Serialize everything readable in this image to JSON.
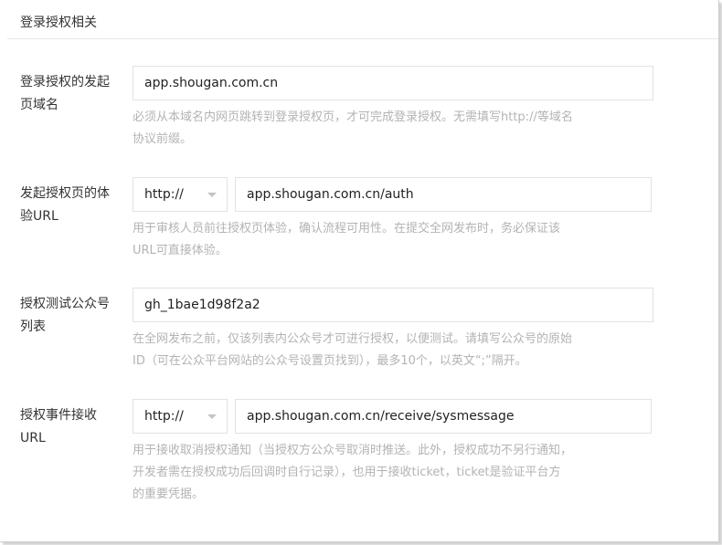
{
  "section": {
    "title": "登录授权相关"
  },
  "fields": [
    {
      "label_line1": "登录授权的发起",
      "label_line2": "页域名",
      "value": "app.shougan.com.cn",
      "hint_line1": "必须从本域名内网页跳转到登录授权页，才可完成登录授权。无需填写http://等域名",
      "hint_line2": "协议前缀。"
    },
    {
      "label_line1": "发起授权页的体",
      "label_line2": "验URL",
      "protocol": "http://",
      "value": "app.shougan.com.cn/auth",
      "hint_line1": "用于审核人员前往授权页体验，确认流程可用性。在提交全网发布时，务必保证该",
      "hint_line2": "URL可直接体验。"
    },
    {
      "label_line1": "授权测试公众号",
      "label_line2": "列表",
      "value": "gh_1bae1d98f2a2",
      "hint_line1": "在全网发布之前，仅该列表内公众号才可进行授权，以便测试。请填写公众号的原始",
      "hint_line2": "ID（可在公众平台网站的公众号设置页找到），最多10个，以英文“;”隔开。"
    },
    {
      "label_line1": "授权事件接收",
      "label_line2": "URL",
      "protocol": "http://",
      "value": "app.shougan.com.cn/receive/sysmessage",
      "hint_line1": "用于接收取消授权通知（当授权方公众号取消时推送。此外，授权成功不另行通知，",
      "hint_line2": "开发者需在授权成功后回调时自行记录），也用于接收ticket，ticket是验证平台方",
      "hint_line3": "的重要凭据。"
    }
  ]
}
